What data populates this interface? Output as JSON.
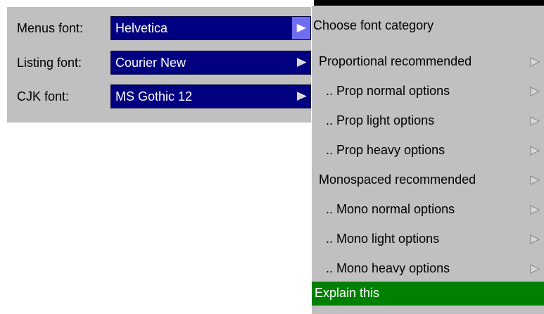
{
  "settings": {
    "menus_font": {
      "label": "Menus font:",
      "value": "Helvetica"
    },
    "listing_font": {
      "label": "Listing font:",
      "value": "Courier New"
    },
    "cjk_font": {
      "label": "CJK font:",
      "value": "MS Gothic 12"
    }
  },
  "menu": {
    "header": "Choose font category",
    "items": [
      {
        "label": "Proportional recommended"
      },
      {
        "label": ".. Prop normal options"
      },
      {
        "label": ".. Prop light options"
      },
      {
        "label": ".. Prop heavy options"
      },
      {
        "label": "Monospaced recommended"
      },
      {
        "label": ".. Mono normal options"
      },
      {
        "label": ".. Mono light options"
      },
      {
        "label": ".. Mono heavy options"
      }
    ],
    "explain_label": "Explain this"
  },
  "colors": {
    "panel_bg": "#c0c0c0",
    "field_bg": "#000080",
    "active_arrow_bg": "#6e6ef0",
    "explain_bg": "#008000"
  },
  "icons": {
    "field_arrow": "submenu-triangle-icon",
    "menu_arrow": "submenu-triangle-icon"
  }
}
